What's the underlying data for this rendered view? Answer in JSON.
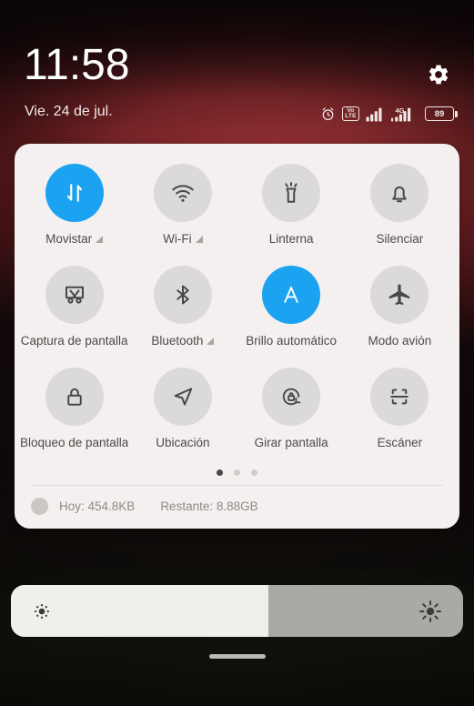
{
  "status_bar": {
    "clock": "11:58",
    "date": "Vie. 24 de jul.",
    "settings_icon": "gear-icon",
    "icons": [
      {
        "name": "alarm-icon",
        "label": "alarm"
      },
      {
        "name": "volte-icon",
        "line1": "Vo",
        "line2": "LTE"
      },
      {
        "name": "signal-sim1-icon",
        "bars": 4,
        "label": "signal"
      },
      {
        "name": "signal-sim2-icon",
        "bars": 4,
        "label": "4G",
        "network": "4G"
      },
      {
        "name": "battery-icon",
        "level": "89"
      }
    ]
  },
  "quick_settings": {
    "tiles": [
      {
        "label": "Movistar",
        "icon": "mobile-data-icon",
        "active": true,
        "expandable": true
      },
      {
        "label": "Wi-Fi",
        "icon": "wifi-icon",
        "active": false,
        "expandable": true
      },
      {
        "label": "Linterna",
        "icon": "flashlight-icon",
        "active": false,
        "expandable": false
      },
      {
        "label": "Silenciar",
        "icon": "bell-icon",
        "active": false,
        "expandable": false
      },
      {
        "label": "Captura de pantalla",
        "icon": "screenshot-icon",
        "active": false,
        "expandable": false
      },
      {
        "label": "Bluetooth",
        "icon": "bluetooth-icon",
        "active": false,
        "expandable": true
      },
      {
        "label": "Brillo automático",
        "icon": "auto-brightness-icon",
        "active": true,
        "expandable": false
      },
      {
        "label": "Modo avión",
        "icon": "airplane-icon",
        "active": false,
        "expandable": false
      },
      {
        "label": "Bloqueo de pantalla",
        "icon": "lock-icon",
        "active": false,
        "expandable": false
      },
      {
        "label": "Ubicación",
        "icon": "location-icon",
        "active": false,
        "expandable": false
      },
      {
        "label": "Girar pantalla",
        "icon": "rotate-lock-icon",
        "active": false,
        "expandable": false
      },
      {
        "label": "Escáner",
        "icon": "scanner-icon",
        "active": false,
        "expandable": false
      }
    ],
    "pager": {
      "count": 3,
      "active_index": 0
    },
    "data_usage": {
      "today_label": "Hoy: 454.8KB",
      "remaining_label": "Restante: 8.88GB"
    }
  },
  "brightness": {
    "value_percent": 57,
    "low_icon": "brightness-low-icon",
    "high_icon": "brightness-high-icon"
  },
  "navigation": {
    "home_indicator": "home-indicator"
  },
  "colors": {
    "accent": "#1ba2f1",
    "panel_bg": "#f4f0ef",
    "tile_off_bg": "#dcdad8",
    "tile_icon": "#4a4847",
    "label_text": "#4c4a49",
    "muted_text": "#8d8a88",
    "status_text": "#efe6e6",
    "slider_track": "#a9aaa5",
    "slider_fill": "#f1efec"
  }
}
